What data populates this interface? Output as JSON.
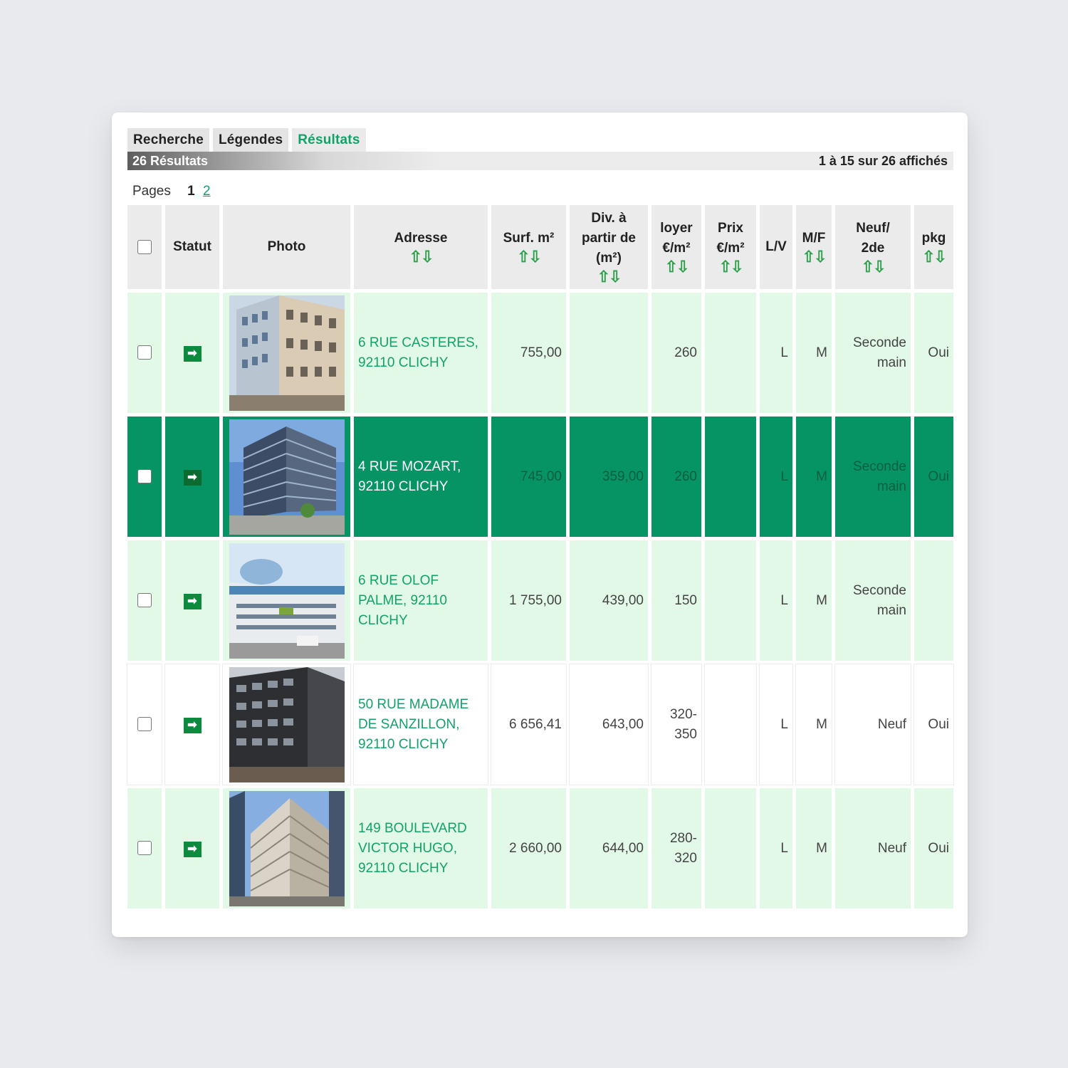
{
  "tabs": [
    {
      "label": "Recherche"
    },
    {
      "label": "Légendes"
    },
    {
      "label": "Résultats"
    }
  ],
  "results_bar": {
    "count": "26 Résultats",
    "display": "1 à 15 sur 26 affichés"
  },
  "pager": {
    "label": "Pages",
    "current": "1",
    "other": "2"
  },
  "headers": {
    "statut": "Statut",
    "photo": "Photo",
    "adresse": "Adresse",
    "surf": "Surf. m²",
    "div_line1": "Div. à",
    "div_line2": "partir de",
    "div_line3": "(m²)",
    "loyer_line1": "loyer",
    "loyer_line2": "€/m²",
    "prix_line1": "Prix",
    "prix_line2": "€/m²",
    "lv": "L/V",
    "mf": "M/F",
    "neuf_line1": "Neuf/",
    "neuf_line2": "2de",
    "pkg": "pkg",
    "sort_glyph": "⇧⇩"
  },
  "rows": [
    {
      "statut_icon": "arrow-right-icon",
      "address": "6 RUE CASTERES, 92110 CLICHY",
      "surf": "755,00",
      "div": "",
      "loyer": "260",
      "prix": "",
      "lv": "L",
      "mf": "M",
      "neuf": "Seconde main",
      "pkg": "Oui"
    },
    {
      "statut_icon": "arrow-right-icon",
      "address": "4 RUE MOZART, 92110 CLICHY",
      "surf": "745,00",
      "div": "359,00",
      "loyer": "260",
      "prix": "",
      "lv": "L",
      "mf": "M",
      "neuf": "Seconde main",
      "pkg": "Oui"
    },
    {
      "statut_icon": "arrow-right-icon",
      "address": "6 RUE OLOF PALME, 92110 CLICHY",
      "surf": "1 755,00",
      "div": "439,00",
      "loyer": "150",
      "prix": "",
      "lv": "L",
      "mf": "M",
      "neuf": "Seconde main",
      "pkg": ""
    },
    {
      "statut_icon": "arrow-right-icon",
      "address": "50 RUE MADAME DE SANZILLON, 92110 CLICHY",
      "surf": "6 656,41",
      "div": "643,00",
      "loyer": "320-350",
      "prix": "",
      "lv": "L",
      "mf": "M",
      "neuf": "Neuf",
      "pkg": "Oui"
    },
    {
      "statut_icon": "arrow-right-icon",
      "address": "149 BOULEVARD VICTOR HUGO, 92110 CLICHY",
      "surf": "2 660,00",
      "div": "644,00",
      "loyer": "280-320",
      "prix": "",
      "lv": "L",
      "mf": "M",
      "neuf": "Neuf",
      "pkg": "Oui"
    }
  ],
  "colors": {
    "accent": "#12a269",
    "selected_row": "#069465",
    "row_bg": "#e3f9e8",
    "header_bg": "#ebebeb",
    "page_bg": "#e9eaee"
  }
}
